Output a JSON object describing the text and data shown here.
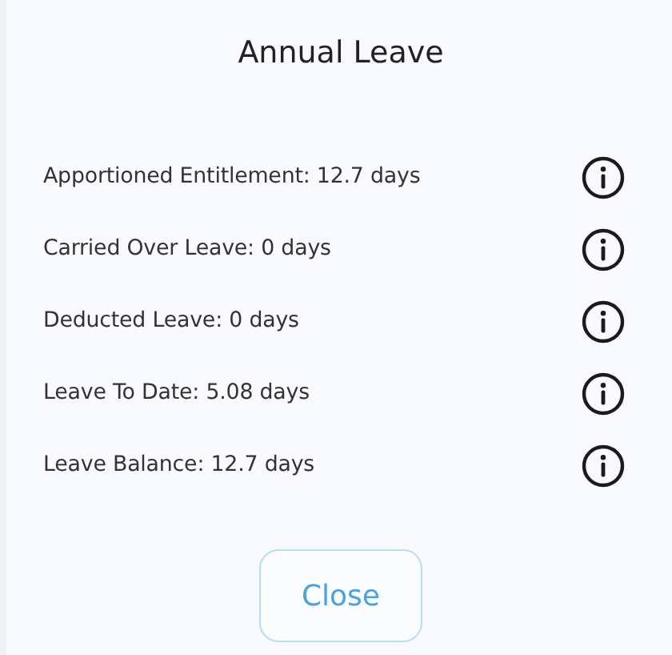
{
  "title": "Annual Leave",
  "items": [
    {
      "label": "Apportioned Entitlement: 12.7 days"
    },
    {
      "label": "Carried Over Leave: 0 days"
    },
    {
      "label": "Deducted Leave: 0 days"
    },
    {
      "label": "Leave To Date: 5.08 days"
    },
    {
      "label": "Leave Balance: 12.7 days"
    }
  ],
  "button": "Close"
}
